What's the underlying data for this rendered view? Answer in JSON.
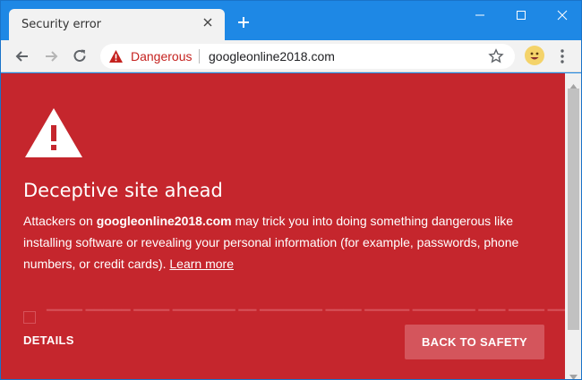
{
  "tab": {
    "title": "Security error"
  },
  "window": {
    "controls": [
      "minimize-icon",
      "maximize-icon",
      "close-icon"
    ]
  },
  "omnibox": {
    "security_label": "Dangerous",
    "url": "googleonline2018.com"
  },
  "interstitial": {
    "heading": "Deceptive site ahead",
    "desc_prefix": "Attackers on ",
    "desc_domain": "googleonline2018.com",
    "desc_suffix": " may trick you into doing something dangerous like installing software or revealing your personal information (for example, passwords, phone numbers, or credit cards). ",
    "learn_more": "Learn more",
    "details_button": "DETAILS",
    "back_button": "BACK TO SAFETY",
    "background_color": "#c5262d"
  },
  "colors": {
    "titlebar": "#1e88e5",
    "toolbar": "#f2f2f2",
    "danger_text": "#c5221f"
  }
}
